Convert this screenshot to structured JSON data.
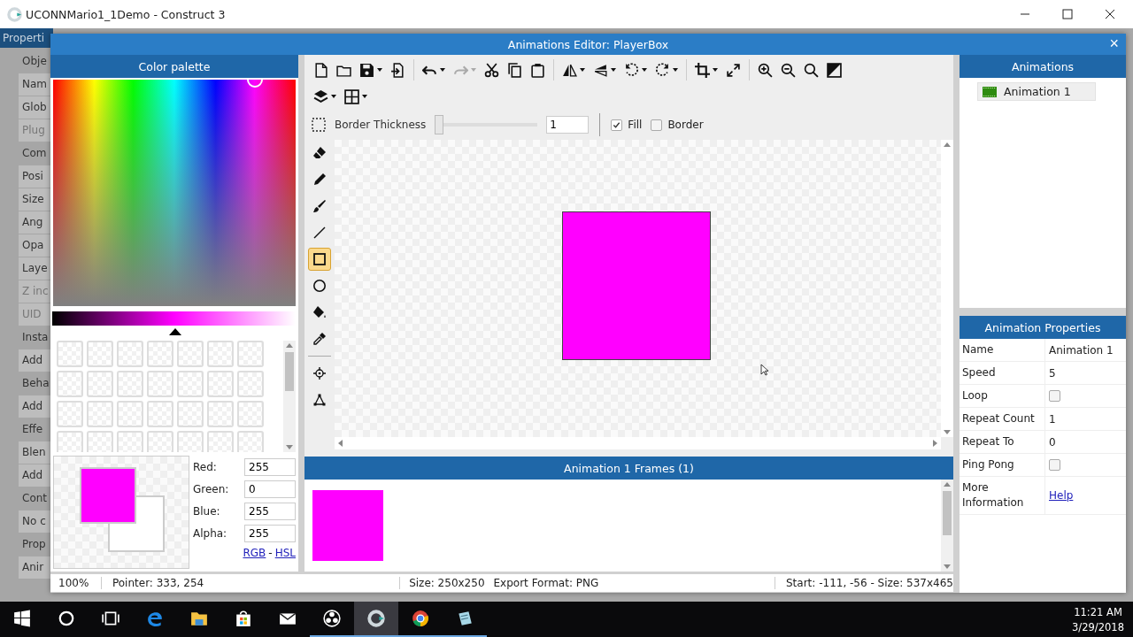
{
  "window": {
    "title": "UCONNMario1_1Demo - Construct 3"
  },
  "background_panel": {
    "tab": "Properti",
    "rows": [
      {
        "text": "Obje",
        "kind": "section",
        "disabled": false
      },
      {
        "text": "Nam",
        "kind": "row",
        "disabled": false
      },
      {
        "text": "Glob",
        "kind": "row",
        "disabled": false
      },
      {
        "text": "Plug",
        "kind": "row",
        "disabled": true
      },
      {
        "text": "Com",
        "kind": "section",
        "disabled": false
      },
      {
        "text": "Posi",
        "kind": "row",
        "disabled": false
      },
      {
        "text": "Size",
        "kind": "row",
        "disabled": false
      },
      {
        "text": "Ang",
        "kind": "row",
        "disabled": false
      },
      {
        "text": "Opa",
        "kind": "row",
        "disabled": false
      },
      {
        "text": "Laye",
        "kind": "row",
        "disabled": false
      },
      {
        "text": "Z inc",
        "kind": "row",
        "disabled": true
      },
      {
        "text": "UID",
        "kind": "row",
        "disabled": true
      },
      {
        "text": "Insta",
        "kind": "section",
        "disabled": false
      },
      {
        "text": "Add",
        "kind": "row",
        "disabled": false
      },
      {
        "text": "Beha",
        "kind": "section",
        "disabled": false
      },
      {
        "text": "Add",
        "kind": "row",
        "disabled": false
      },
      {
        "text": "Effe",
        "kind": "section",
        "disabled": false
      },
      {
        "text": "Blen",
        "kind": "row",
        "disabled": false
      },
      {
        "text": "Add",
        "kind": "row",
        "disabled": false
      },
      {
        "text": "Cont",
        "kind": "section",
        "disabled": false
      },
      {
        "text": "No c",
        "kind": "row",
        "disabled": false
      },
      {
        "text": "Prop",
        "kind": "section",
        "disabled": false
      },
      {
        "text": "Anir",
        "kind": "row",
        "disabled": false
      }
    ]
  },
  "dialog": {
    "title": "Animations Editor: PlayerBox",
    "close": "×"
  },
  "color_palette": {
    "title": "Color palette",
    "fields": [
      {
        "label": "Red:",
        "value": "255"
      },
      {
        "label": "Green:",
        "value": "0"
      },
      {
        "label": "Blue:",
        "value": "255"
      },
      {
        "label": "Alpha:",
        "value": "255"
      }
    ],
    "links": [
      "RGB",
      "HSL"
    ],
    "link_separator": "-",
    "shade_slider": {
      "level": 0.5
    }
  },
  "toolbar": {
    "rows": [
      [
        {
          "kind": "new",
          "menu": false,
          "disabled": false
        },
        {
          "kind": "open",
          "menu": false,
          "disabled": false
        },
        {
          "kind": "save",
          "menu": true,
          "disabled": false
        },
        {
          "kind": "export",
          "menu": false,
          "disabled": false
        },
        {
          "kind": "separator"
        },
        {
          "kind": "undo",
          "menu": true,
          "disabled": false
        },
        {
          "kind": "redo",
          "menu": true,
          "disabled": true
        },
        {
          "kind": "cut",
          "menu": false,
          "disabled": false
        },
        {
          "kind": "copy",
          "menu": false,
          "disabled": false
        },
        {
          "kind": "paste",
          "menu": false,
          "disabled": false
        },
        {
          "kind": "separator"
        },
        {
          "kind": "fliph",
          "menu": true,
          "disabled": false
        },
        {
          "kind": "flipv",
          "menu": true,
          "disabled": false
        },
        {
          "kind": "rotl",
          "menu": true,
          "disabled": false
        },
        {
          "kind": "rotr",
          "menu": true,
          "disabled": false
        },
        {
          "kind": "separator"
        },
        {
          "kind": "crop",
          "menu": true,
          "disabled": false
        },
        {
          "kind": "resize",
          "menu": false,
          "disabled": false
        },
        {
          "kind": "separator"
        },
        {
          "kind": "zoomin",
          "menu": false,
          "disabled": false
        },
        {
          "kind": "zoomout",
          "menu": false,
          "disabled": false
        },
        {
          "kind": "zoom",
          "menu": false,
          "disabled": false
        },
        {
          "kind": "contrast",
          "menu": false,
          "disabled": false
        }
      ],
      [
        {
          "kind": "layers",
          "menu": true,
          "disabled": false
        },
        {
          "kind": "grid",
          "menu": true,
          "disabled": false
        }
      ]
    ],
    "border_thickness": {
      "label": "Border Thickness",
      "level": 0,
      "value": "1"
    },
    "checkboxes": [
      {
        "label": "Fill",
        "checked": true
      },
      {
        "label": "Border",
        "checked": false
      }
    ]
  },
  "tools": [
    {
      "kind": "eraser",
      "selected": false
    },
    {
      "kind": "pencil",
      "selected": false
    },
    {
      "kind": "brush",
      "selected": false
    },
    {
      "kind": "line",
      "selected": false
    },
    {
      "kind": "rectangle",
      "selected": true
    },
    {
      "kind": "ellipse",
      "selected": false
    },
    {
      "kind": "fill",
      "selected": false
    },
    {
      "kind": "picker",
      "selected": false
    },
    {
      "kind": "separator"
    },
    {
      "kind": "origin",
      "selected": false
    },
    {
      "kind": "polygon",
      "selected": false
    }
  ],
  "frames_panel": {
    "title": "Animation 1 Frames (1)",
    "frames": [
      {
        "color": "#ff00ff"
      }
    ]
  },
  "status_bar": {
    "zoom": "100%",
    "pointer": "Pointer: 333, 254",
    "size": "Size: 250x250",
    "format": "Export Format: PNG",
    "selection": "Start: -111, -56 - Size: 537x465"
  },
  "animations_panel": {
    "title": "Animations",
    "items": [
      {
        "name": "Animation 1",
        "selected": true
      }
    ]
  },
  "properties_panel": {
    "title": "Animation Properties",
    "rows": [
      {
        "label": "Name",
        "kind": "text",
        "value": "Animation 1"
      },
      {
        "label": "Speed",
        "kind": "text",
        "value": "5"
      },
      {
        "label": "Loop",
        "kind": "checkbox",
        "checked": false
      },
      {
        "label": "Repeat Count",
        "kind": "text",
        "value": "1"
      },
      {
        "label": "Repeat To",
        "kind": "text",
        "value": "0"
      },
      {
        "label": "Ping Pong",
        "kind": "checkbox",
        "checked": false
      },
      {
        "label": "More Information",
        "kind": "link",
        "value": "Help"
      }
    ]
  },
  "taskbar": {
    "apps": [
      {
        "kind": "start",
        "selected": false,
        "running": false
      },
      {
        "kind": "search",
        "selected": false,
        "running": false
      },
      {
        "kind": "taskview",
        "selected": false,
        "running": false
      },
      {
        "kind": "edge",
        "selected": false,
        "running": false
      },
      {
        "kind": "explorer",
        "selected": false,
        "running": false
      },
      {
        "kind": "store",
        "selected": false,
        "running": false
      },
      {
        "kind": "mail",
        "selected": false,
        "running": false
      },
      {
        "kind": "obs",
        "selected": false,
        "running": true
      },
      {
        "kind": "construct",
        "selected": true,
        "running": true
      },
      {
        "kind": "chrome",
        "selected": false,
        "running": true
      },
      {
        "kind": "notes",
        "selected": false,
        "running": true
      }
    ],
    "time": "11:21 AM",
    "date": "3/29/2018"
  }
}
